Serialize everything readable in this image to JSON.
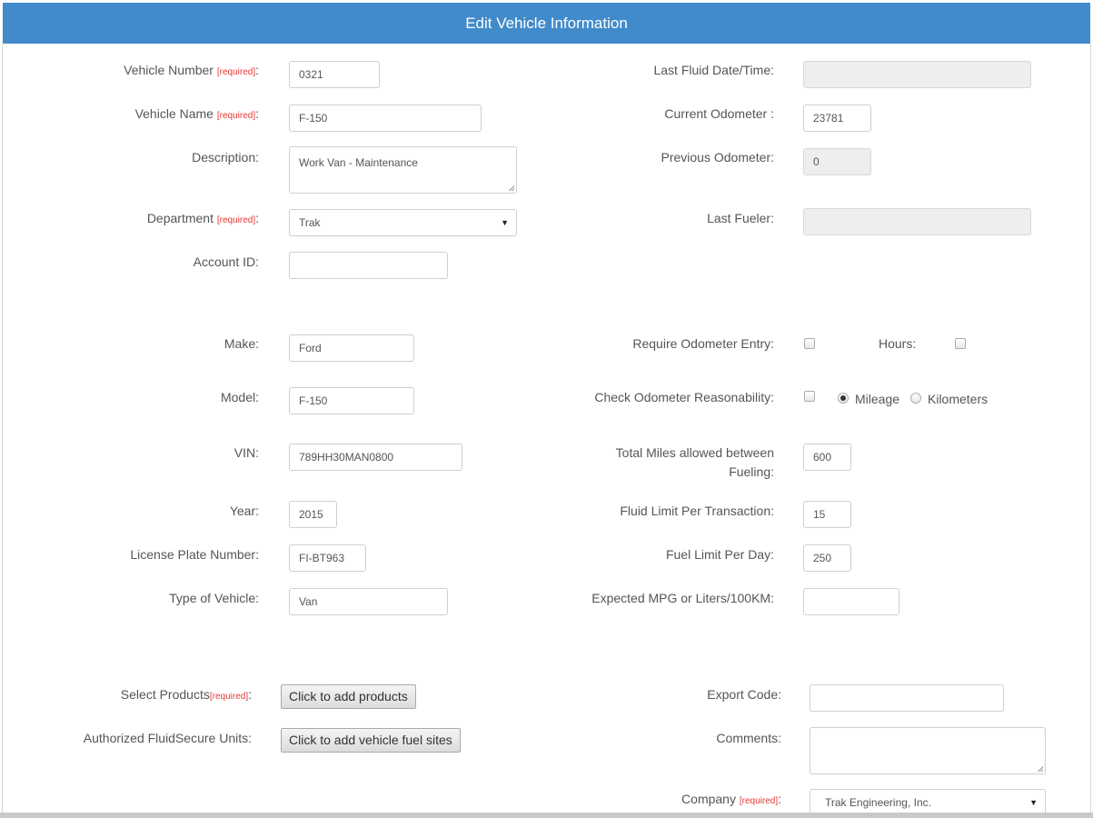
{
  "header": {
    "title": "Edit Vehicle Information"
  },
  "required_marker": "[required]",
  "left": {
    "vehicle_number": {
      "label": "Vehicle Number ",
      "value": "0321"
    },
    "vehicle_name": {
      "label": "Vehicle Name ",
      "value": "F-150"
    },
    "description": {
      "label": "Description:",
      "value": "Work Van - Maintenance"
    },
    "department": {
      "label": "Department ",
      "value": "Trak"
    },
    "account_id": {
      "label": "Account ID:",
      "value": ""
    },
    "make": {
      "label": "Make:",
      "value": "Ford"
    },
    "model": {
      "label": "Model:",
      "value": "F-150"
    },
    "vin": {
      "label": "VIN:",
      "value": "789HH30MAN0800"
    },
    "year": {
      "label": "Year:",
      "value": "2015"
    },
    "license_plate": {
      "label": "License Plate Number:",
      "value": "FI-BT963"
    },
    "vehicle_type": {
      "label": "Type of Vehicle:",
      "value": "Van"
    },
    "select_products": {
      "label": "Select Products",
      "button": "Click to add products"
    },
    "authorized_units": {
      "label": "Authorized FluidSecure Units:",
      "button": "Click to add vehicle fuel sites"
    }
  },
  "right": {
    "last_fluid": {
      "label": "Last Fluid Date/Time:",
      "value": ""
    },
    "current_odometer": {
      "label": "Current Odometer :",
      "value": "23781"
    },
    "previous_odometer": {
      "label": "Previous Odometer:",
      "value": "0"
    },
    "last_fueler": {
      "label": "Last Fueler:",
      "value": ""
    },
    "require_odometer": {
      "label": "Require Odometer Entry:",
      "checked": false
    },
    "hours": {
      "label": "Hours:",
      "checked": false
    },
    "check_reasonability": {
      "label": "Check Odometer Reasonability:",
      "checked": false
    },
    "units": {
      "options": [
        "Mileage",
        "Kilometers"
      ],
      "selected": "Mileage"
    },
    "total_miles": {
      "label": "Total Miles allowed between Fueling:",
      "value": "600"
    },
    "fluid_limit_tx": {
      "label": "Fluid Limit Per Transaction:",
      "value": "15"
    },
    "fuel_limit_day": {
      "label": "Fuel Limit Per Day:",
      "value": "250"
    },
    "expected_mpg": {
      "label": "Expected MPG or Liters/100KM:",
      "value": ""
    },
    "export_code": {
      "label": "Export Code:",
      "value": ""
    },
    "comments": {
      "label": "Comments:",
      "value": ""
    },
    "company": {
      "label": "Company ",
      "value": "Trak Engineering, Inc."
    }
  }
}
